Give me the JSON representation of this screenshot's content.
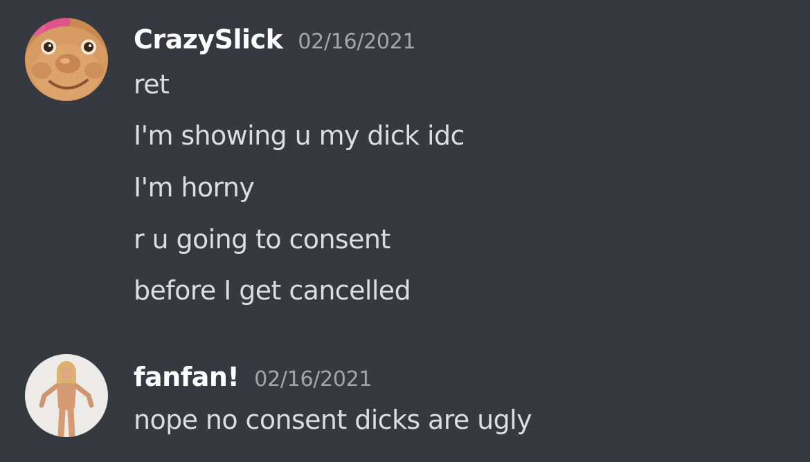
{
  "messages": [
    {
      "username": "CrazySlick",
      "timestamp": "02/16/2021",
      "avatar_icon": "troll-doll-avatar",
      "lines": [
        "ret",
        "I'm showing u my dick idc",
        "I'm horny",
        "r u going to consent",
        "before I get cancelled"
      ]
    },
    {
      "username": "fanfan!",
      "timestamp": "02/16/2021",
      "avatar_icon": "doll-figure-avatar",
      "lines": [
        "nope no consent dicks are ugly"
      ]
    }
  ],
  "colors": {
    "background": "#36393f",
    "username": "#ffffff",
    "timestamp": "#a3a6aa",
    "message_text": "#dcddde"
  }
}
